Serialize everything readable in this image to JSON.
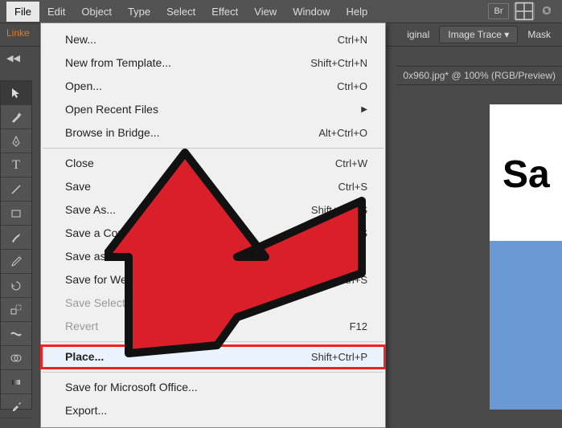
{
  "menubar": {
    "items": [
      "File",
      "Edit",
      "Object",
      "Type",
      "Select",
      "Effect",
      "View",
      "Window",
      "Help"
    ],
    "active": 0,
    "br_label": "Br"
  },
  "secondbar": {
    "left_btn": "Linke",
    "right_items": [
      "iginal",
      "Image Trace",
      "Mask"
    ]
  },
  "doc_tab": "0x960.jpg* @ 100% (RGB/Preview)",
  "canvas_text": "Sa",
  "tools": [
    "selection",
    "magic-wand",
    "pen",
    "type",
    "line",
    "rect",
    "brush",
    "pencil",
    "rotate",
    "scale",
    "width",
    "shape-builder",
    "mesh",
    "gradient",
    "eyedropper",
    "blend",
    "crop",
    "artboard"
  ],
  "file_menu": [
    {
      "type": "item",
      "label": "New...",
      "shortcut": "Ctrl+N"
    },
    {
      "type": "item",
      "label": "New from Template...",
      "shortcut": "Shift+Ctrl+N"
    },
    {
      "type": "item",
      "label": "Open...",
      "shortcut": "Ctrl+O"
    },
    {
      "type": "submenu",
      "label": "Open Recent Files"
    },
    {
      "type": "item",
      "label": "Browse in Bridge...",
      "shortcut": "Alt+Ctrl+O"
    },
    {
      "type": "sep"
    },
    {
      "type": "item",
      "label": "Close",
      "shortcut": "Ctrl+W"
    },
    {
      "type": "item",
      "label": "Save",
      "shortcut": "Ctrl+S"
    },
    {
      "type": "item",
      "label": "Save As...",
      "shortcut": "Shift+Ctrl+S"
    },
    {
      "type": "item",
      "label": "Save a Copy...",
      "shortcut": "Alt+Ctrl+S"
    },
    {
      "type": "item",
      "label": "Save as Template..."
    },
    {
      "type": "item",
      "label": "Save for Web...",
      "shortcut": "Alt+Shift+Ctrl+S"
    },
    {
      "type": "item",
      "label": "Save Selected Slices...",
      "disabled": true
    },
    {
      "type": "item",
      "label": "Revert",
      "shortcut": "F12",
      "disabled": true
    },
    {
      "type": "sep"
    },
    {
      "type": "item",
      "label": "Place...",
      "shortcut": "Shift+Ctrl+P",
      "highlight": true
    },
    {
      "type": "sep"
    },
    {
      "type": "item",
      "label": "Save for Microsoft Office..."
    },
    {
      "type": "item",
      "label": "Export..."
    }
  ]
}
